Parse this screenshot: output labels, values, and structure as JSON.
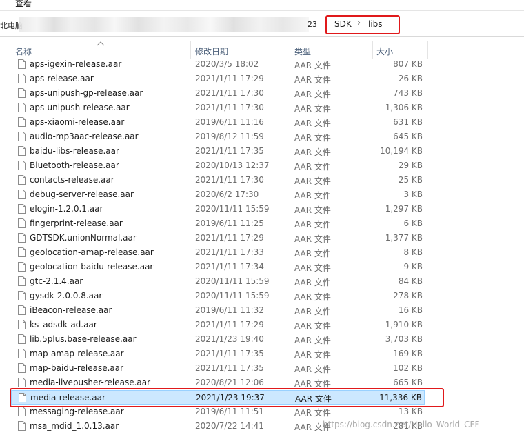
{
  "menubar": {
    "view_label": "查看"
  },
  "address": {
    "prefix": "北电脑",
    "suffix": "23",
    "crumbs": [
      "SDK",
      "libs"
    ]
  },
  "columns": {
    "name": "名称",
    "date": "修改日期",
    "type": "类型",
    "size": "大小"
  },
  "files": [
    {
      "name": "aps-igexin-release.aar",
      "date": "2020/3/5 18:02",
      "type": "AAR 文件",
      "size": "807 KB"
    },
    {
      "name": "aps-release.aar",
      "date": "2021/1/11 17:29",
      "type": "AAR 文件",
      "size": "26 KB"
    },
    {
      "name": "aps-unipush-gp-release.aar",
      "date": "2021/1/11 17:30",
      "type": "AAR 文件",
      "size": "743 KB"
    },
    {
      "name": "aps-unipush-release.aar",
      "date": "2021/1/11 17:30",
      "type": "AAR 文件",
      "size": "1,306 KB"
    },
    {
      "name": "aps-xiaomi-release.aar",
      "date": "2019/6/11 11:16",
      "type": "AAR 文件",
      "size": "631 KB"
    },
    {
      "name": "audio-mp3aac-release.aar",
      "date": "2019/8/12 11:59",
      "type": "AAR 文件",
      "size": "645 KB"
    },
    {
      "name": "baidu-libs-release.aar",
      "date": "2021/1/11 17:35",
      "type": "AAR 文件",
      "size": "10,194 KB"
    },
    {
      "name": "Bluetooth-release.aar",
      "date": "2020/10/13 12:37",
      "type": "AAR 文件",
      "size": "29 KB"
    },
    {
      "name": "contacts-release.aar",
      "date": "2021/1/11 17:30",
      "type": "AAR 文件",
      "size": "25 KB"
    },
    {
      "name": "debug-server-release.aar",
      "date": "2020/6/2 17:30",
      "type": "AAR 文件",
      "size": "3 KB"
    },
    {
      "name": "elogin-1.2.0.1.aar",
      "date": "2020/11/11 15:59",
      "type": "AAR 文件",
      "size": "1,297 KB"
    },
    {
      "name": "fingerprint-release.aar",
      "date": "2019/6/11 11:25",
      "type": "AAR 文件",
      "size": "6 KB"
    },
    {
      "name": "GDTSDK.unionNormal.aar",
      "date": "2021/1/11 17:29",
      "type": "AAR 文件",
      "size": "1,377 KB"
    },
    {
      "name": "geolocation-amap-release.aar",
      "date": "2021/1/11 17:33",
      "type": "AAR 文件",
      "size": "8 KB"
    },
    {
      "name": "geolocation-baidu-release.aar",
      "date": "2021/1/11 17:34",
      "type": "AAR 文件",
      "size": "9 KB"
    },
    {
      "name": "gtc-2.1.4.aar",
      "date": "2020/11/11 15:59",
      "type": "AAR 文件",
      "size": "84 KB"
    },
    {
      "name": "gysdk-2.0.0.8.aar",
      "date": "2020/11/11 15:59",
      "type": "AAR 文件",
      "size": "278 KB"
    },
    {
      "name": "iBeacon-release.aar",
      "date": "2019/6/11 11:32",
      "type": "AAR 文件",
      "size": "16 KB"
    },
    {
      "name": "ks_adsdk-ad.aar",
      "date": "2021/1/11 17:29",
      "type": "AAR 文件",
      "size": "1,910 KB"
    },
    {
      "name": "lib.5plus.base-release.aar",
      "date": "2021/1/23 19:40",
      "type": "AAR 文件",
      "size": "3,703 KB"
    },
    {
      "name": "map-amap-release.aar",
      "date": "2021/1/11 17:35",
      "type": "AAR 文件",
      "size": "169 KB"
    },
    {
      "name": "map-baidu-release.aar",
      "date": "2021/1/11 17:35",
      "type": "AAR 文件",
      "size": "102 KB"
    },
    {
      "name": "media-livepusher-release.aar",
      "date": "2020/8/21 12:06",
      "type": "AAR 文件",
      "size": "665 KB"
    },
    {
      "name": "media-release.aar",
      "date": "2021/1/23 19:37",
      "type": "AAR 文件",
      "size": "11,336 KB",
      "selected": true
    },
    {
      "name": "messaging-release.aar",
      "date": "2019/6/11 11:51",
      "type": "AAR 文件",
      "size": "13 KB"
    },
    {
      "name": "msa_mdid_1.0.13.aar",
      "date": "2020/7/22 14:41",
      "type": "AAR 文件",
      "size": "281 KB"
    }
  ],
  "watermark": "https://blog.csdn.net/Hello_World_CFF"
}
